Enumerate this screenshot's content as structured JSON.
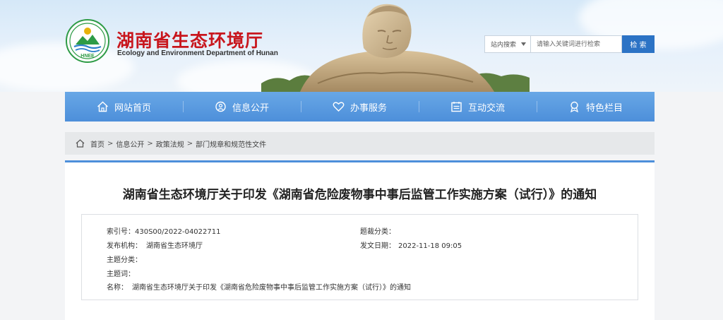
{
  "header": {
    "title": "湖南省生态环境厅",
    "subtitle": "Ecology and Environment Department of Hunan",
    "logo_text": "HNEE",
    "search": {
      "scope_label": "站内搜索",
      "placeholder": "请输入关键词进行检索",
      "button_label": "检 索"
    }
  },
  "nav": {
    "items": [
      {
        "label": "网站首页",
        "icon": "home-icon"
      },
      {
        "label": "信息公开",
        "icon": "info-icon"
      },
      {
        "label": "办事服务",
        "icon": "heart-icon"
      },
      {
        "label": "互动交流",
        "icon": "calendar-icon"
      },
      {
        "label": "特色栏目",
        "icon": "badge-icon"
      }
    ]
  },
  "breadcrumb": {
    "items": [
      "首页",
      "信息公开",
      "政策法规",
      "部门规章和规范性文件"
    ],
    "separator": ">"
  },
  "article": {
    "title": "湖南省生态环境厅关于印发《湖南省危险废物事中事后监管工作实施方案（试行）》的通知",
    "meta": {
      "index_label": "索引号：",
      "index_value": "430S00/2022-04022711",
      "category_label": "题裁分类：",
      "category_value": "",
      "publisher_label": "发布机构：",
      "publisher_value": "湖南省生态环境厅",
      "date_label": "发文日期：",
      "date_value": "2022-11-18 09:05",
      "topic_label": "主题分类：",
      "topic_value": "",
      "keywords_label": "主题词：",
      "keywords_value": "",
      "name_label": "名称：",
      "name_value": "湖南省生态环境厅关于印发《湖南省危险废物事中事后监管工作实施方案（试行）》的通知"
    }
  },
  "colors": {
    "brand_red": "#c8161d",
    "nav_blue": "#4d8fda",
    "search_button": "#2c73c5"
  }
}
